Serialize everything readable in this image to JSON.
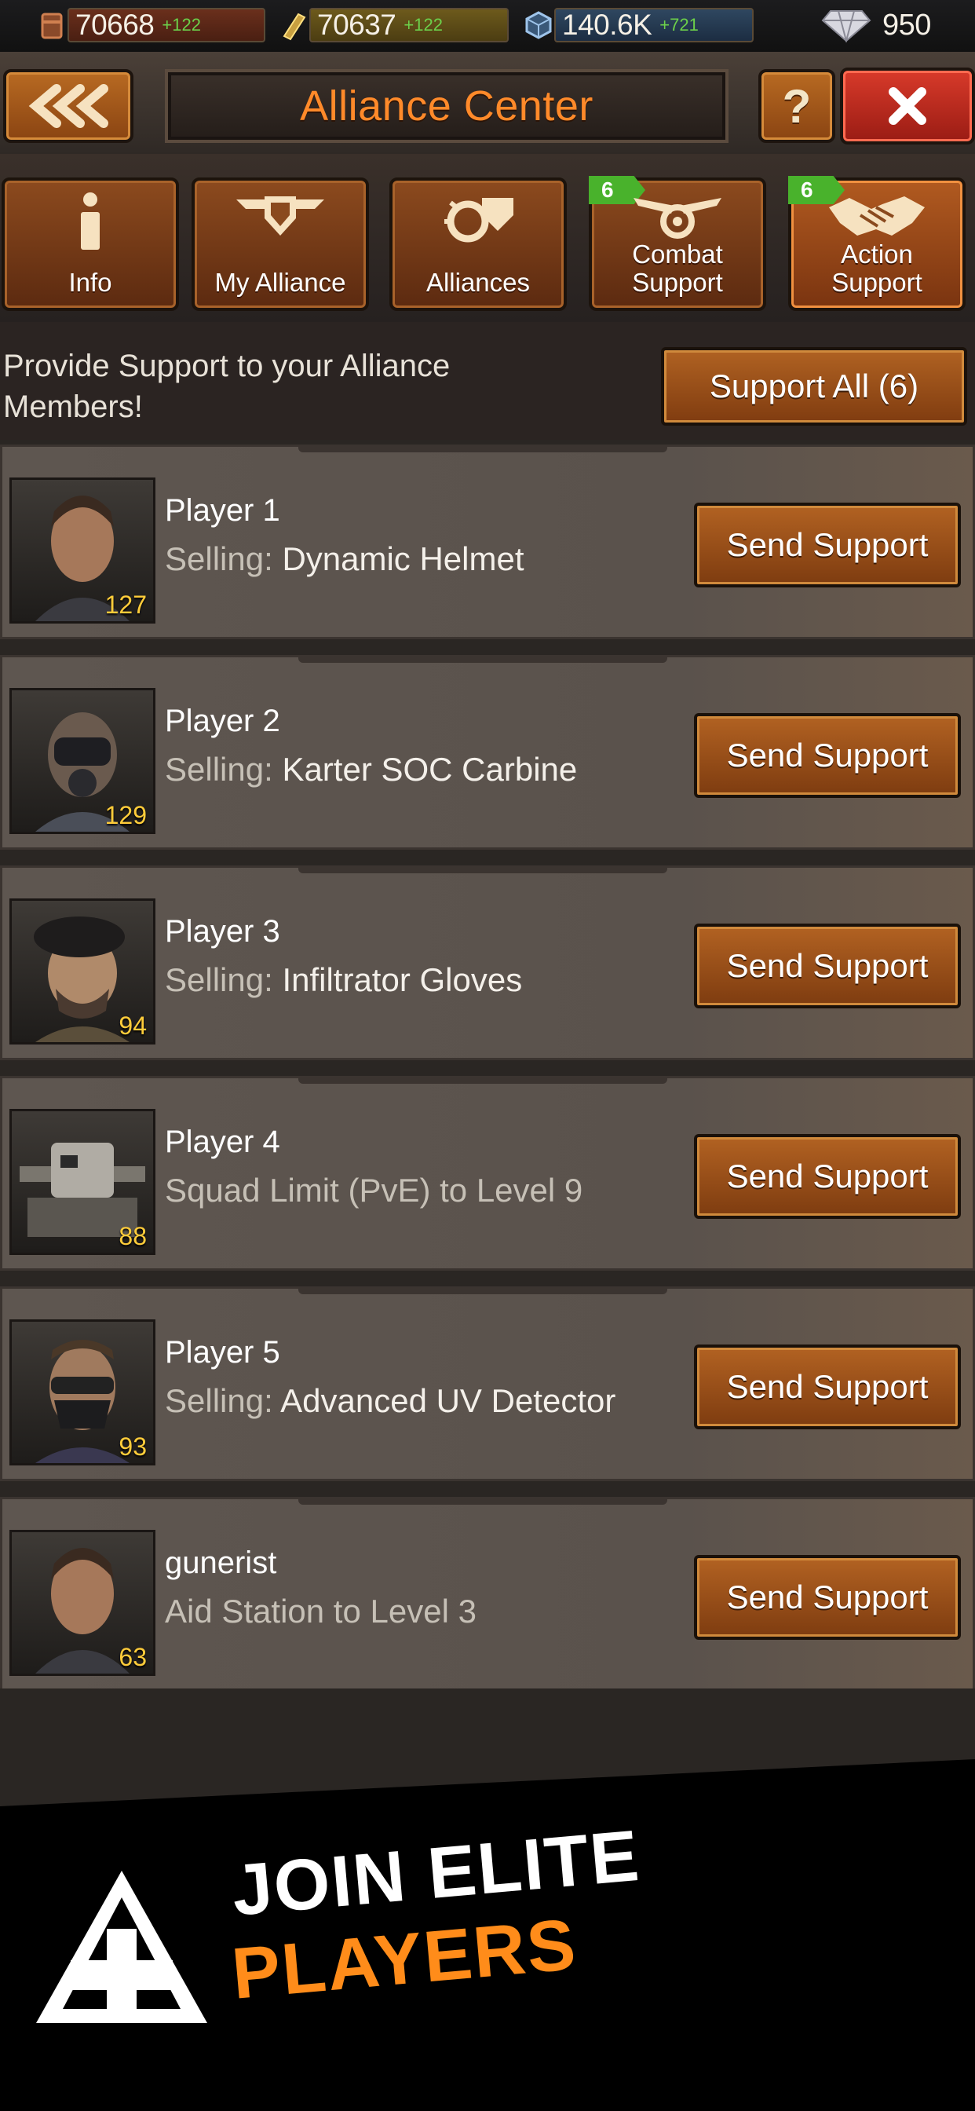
{
  "resources": {
    "ammo": {
      "value": "70668",
      "delta": "+122"
    },
    "gold": {
      "value": "70637",
      "delta": "+122"
    },
    "steel": {
      "value": "140.6K",
      "delta": "+721"
    },
    "gems": {
      "value": "950"
    }
  },
  "header": {
    "title": "Alliance Center",
    "help": "?"
  },
  "tabs": [
    {
      "label": "Info",
      "icon": "info-icon"
    },
    {
      "label": "My Alliance",
      "icon": "alliance-emblem-icon"
    },
    {
      "label": "Alliances",
      "icon": "alliances-icon"
    },
    {
      "label": "Combat\nSupport",
      "icon": "combat-support-icon",
      "badge": "6"
    },
    {
      "label": "Action\nSupport",
      "icon": "handshake-icon",
      "badge": "6",
      "active": true
    }
  ],
  "support": {
    "text": "Provide Support to your Alliance Members!",
    "support_all": "Support All (6)"
  },
  "requests": [
    {
      "name": "Player 1",
      "prefix": "Selling:",
      "detail": "Dynamic Helmet",
      "level": "127",
      "button": "Send Support"
    },
    {
      "name": "Player 2",
      "prefix": "Selling:",
      "detail": "Karter SOC Carbine",
      "level": "129",
      "button": "Send Support"
    },
    {
      "name": "Player 3",
      "prefix": "Selling:",
      "detail": "Infiltrator Gloves",
      "level": "94",
      "button": "Send Support"
    },
    {
      "name": "Player 4",
      "prefix": "",
      "detail": "Squad Limit (PvE) to Level 9",
      "level": "88",
      "button": "Send Support"
    },
    {
      "name": "Player 5",
      "prefix": "Selling:",
      "detail": "Advanced UV Detector",
      "level": "93",
      "button": "Send Support"
    },
    {
      "name": "gunerist",
      "prefix": "",
      "detail": "Aid Station to Level 3",
      "level": "63",
      "button": "Send Support"
    }
  ],
  "banner": {
    "line1": "JOIN ELITE",
    "line2": "PLAYERS"
  },
  "colors": {
    "accent": "#ff8a2a",
    "button": "#b26222",
    "badge": "#49b22c"
  }
}
